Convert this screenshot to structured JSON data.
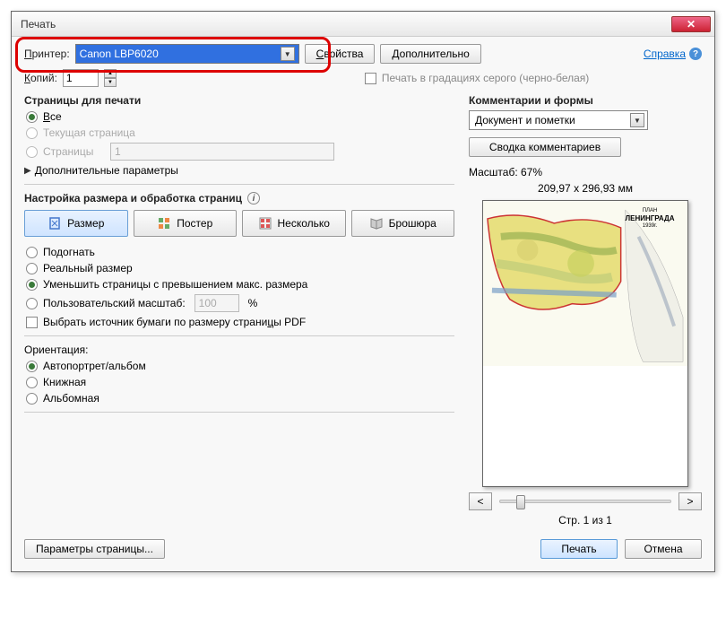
{
  "title": "Печать",
  "close": "✕",
  "printer": {
    "label": "Принтер:",
    "value": "Canon LBP6020"
  },
  "properties_btn": "Свойства",
  "advanced_btn": "Дополнительно",
  "help": "Справка",
  "copies": {
    "label": "Копий:",
    "value": "1"
  },
  "grayscale": "Печать в градациях серого (черно-белая)",
  "pages": {
    "title": "Страницы для печати",
    "all": "Все",
    "current": "Текущая страница",
    "range_label": "Страницы",
    "range_value": "1",
    "more": "Дополнительные параметры"
  },
  "sizing": {
    "title": "Настройка размера и обработка страниц",
    "size_btn": "Размер",
    "poster_btn": "Постер",
    "multiple_btn": "Несколько",
    "booklet_btn": "Брошюра",
    "fit": "Подогнать",
    "actual": "Реальный размер",
    "shrink": "Уменьшить страницы с превышением макс. размера",
    "custom": "Пользовательский масштаб:",
    "custom_value": "100",
    "percent": "%",
    "paper_source": "Выбрать источник бумаги по размеру страницы PDF"
  },
  "orientation": {
    "title": "Ориентация:",
    "auto": "Автопортрет/альбом",
    "portrait": "Книжная",
    "landscape": "Альбомная"
  },
  "comments": {
    "title": "Комментарии и формы",
    "value": "Документ и пометки",
    "summary_btn": "Сводка комментариев"
  },
  "preview": {
    "scale": "Масштаб: 67%",
    "dimensions": "209,97 x 296,93 мм",
    "map_title": "ПЛАН ЛЕНИНГРАДА 1939г.",
    "prev": "<",
    "next": ">",
    "page_info": "Стр. 1 из 1"
  },
  "footer": {
    "page_setup": "Параметры страницы...",
    "print": "Печать",
    "cancel": "Отмена"
  }
}
